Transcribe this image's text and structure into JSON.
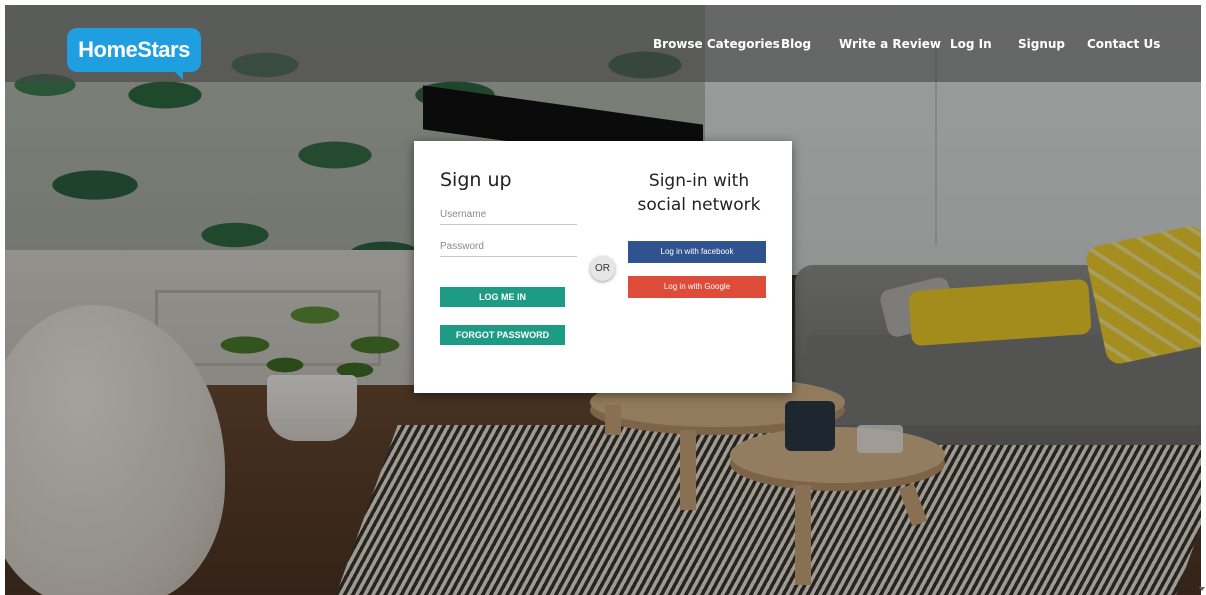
{
  "brand": {
    "logo_text": "HomeStars",
    "accent": "#1f9ee0"
  },
  "nav": {
    "items": [
      {
        "label": "Browse Categories"
      },
      {
        "label": "Blog"
      },
      {
        "label": "Write a Review"
      },
      {
        "label": "Log In"
      },
      {
        "label": "Signup"
      },
      {
        "label": "Contact Us"
      }
    ]
  },
  "signup": {
    "title": "Sign up",
    "username_placeholder": "Username",
    "username_value": "",
    "password_placeholder": "Password",
    "password_value": "",
    "login_button": "LOG ME IN",
    "forgot_button": "FORGOT PASSWORD",
    "button_color": "#1e9b84"
  },
  "divider": {
    "label": "OR"
  },
  "social": {
    "title_line1": "Sign-in with",
    "title_line2": "social network",
    "facebook_button": "Log in with facebook",
    "facebook_color": "#30528e",
    "google_button": "Log in with Google",
    "google_color": "#dd4b39"
  }
}
